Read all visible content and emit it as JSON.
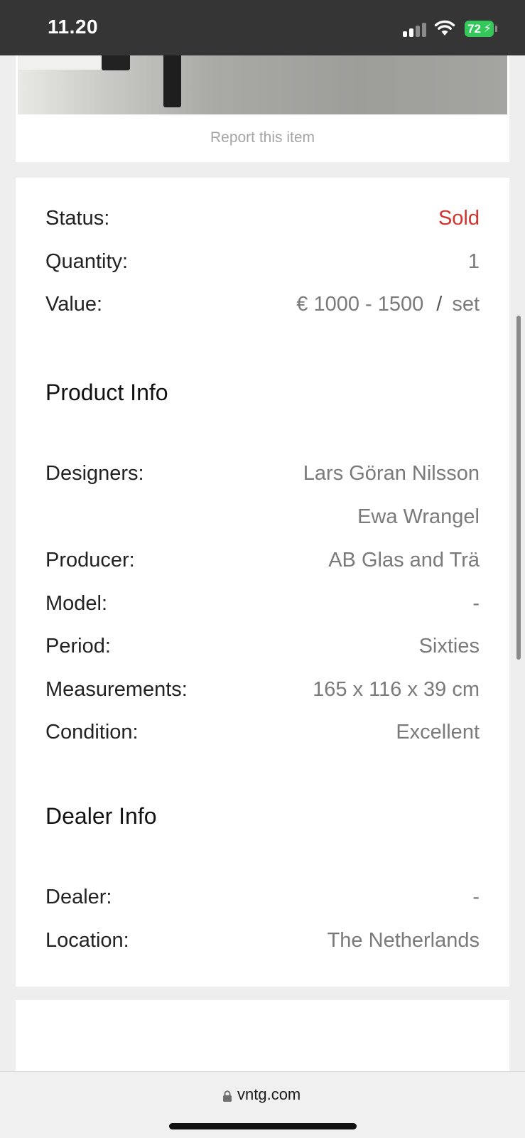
{
  "status_bar": {
    "time": "11.20",
    "battery_level": "72",
    "battery_charging": true,
    "icons": [
      "cellular-signal-icon",
      "wifi-icon",
      "battery-icon"
    ]
  },
  "item": {
    "report_link": "Report this item"
  },
  "details": {
    "status": {
      "label": "Status:",
      "value": "Sold"
    },
    "quantity": {
      "label": "Quantity:",
      "value": "1"
    },
    "value": {
      "label": "Value:",
      "price": "€ 1000 - 1500",
      "separator": "/",
      "unit": "set"
    }
  },
  "product_info": {
    "title": "Product Info",
    "designers": {
      "label": "Designers:",
      "values": [
        "Lars Göran Nilsson",
        "Ewa Wrangel"
      ]
    },
    "producer": {
      "label": "Producer:",
      "value": "AB Glas and Trä"
    },
    "model": {
      "label": "Model:",
      "value": "-"
    },
    "period": {
      "label": "Period:",
      "value": "Sixties"
    },
    "measurements": {
      "label": "Measurements:",
      "value": "165 x 116 x 39 cm"
    },
    "condition": {
      "label": "Condition:",
      "value": "Excellent"
    }
  },
  "dealer_info": {
    "title": "Dealer Info",
    "dealer": {
      "label": "Dealer:",
      "value": "-"
    },
    "location": {
      "label": "Location:",
      "value": "The Netherlands"
    }
  },
  "browser": {
    "url": "vntg.com",
    "lock_icon": "lock-icon"
  },
  "colors": {
    "sold": "#d0342c",
    "status_bar": "#353535",
    "battery": "#34c759",
    "page_background": "#efeeee"
  }
}
